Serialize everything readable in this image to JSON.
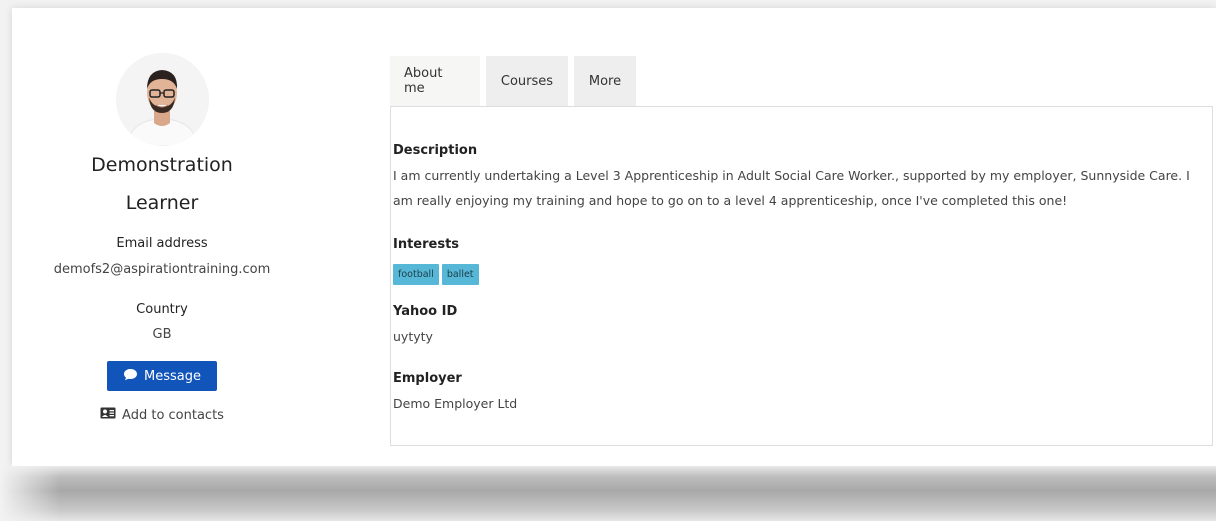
{
  "profile": {
    "first_name": "Demonstration",
    "last_name": "Learner",
    "email_label": "Email address",
    "email_value": "demofs2@aspirationtraining.com",
    "country_label": "Country",
    "country_value": "GB",
    "message_button": "Message",
    "add_contacts": "Add to contacts"
  },
  "tabs": [
    {
      "label": "About me",
      "active": true
    },
    {
      "label": "Courses",
      "active": false
    },
    {
      "label": "More",
      "active": false
    }
  ],
  "about": {
    "description_title": "Description",
    "description_text": "I am currently undertaking a  Level 3 Apprenticeship in Adult Social Care Worker., supported by my employer, Sunnyside Care.  I am really enjoying my training and hope to go on to a level 4 apprenticeship, once I've completed this one!",
    "interests_title": "Interests",
    "interests": [
      "football",
      "ballet"
    ],
    "yahoo_title": "Yahoo ID",
    "yahoo_value": "uytyty",
    "employer_title": "Employer",
    "employer_value": "Demo Employer Ltd"
  },
  "colors": {
    "primary_button": "#1155bb",
    "tag_bg": "#56b8d6"
  },
  "icons": {
    "message": "speech-bubble-icon",
    "contacts": "contact-card-icon"
  }
}
